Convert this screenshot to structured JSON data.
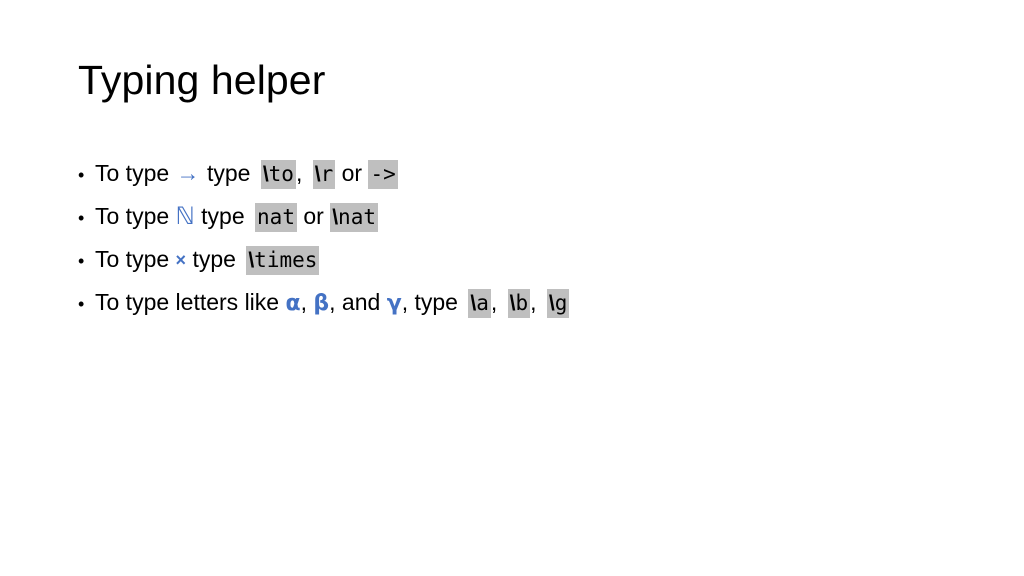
{
  "slide": {
    "title": "Typing helper",
    "background_color": "#FFFFFF",
    "accent_color": "#4472C4",
    "code_highlight_color": "#BFBFBF",
    "text_color": "#000000",
    "bullet_glyph": "•",
    "bullets": [
      {
        "id": "arrow",
        "lead": "To type",
        "symbol": "→",
        "symbol_name": "right-arrow",
        "mid": "type",
        "codes": [
          "\\to",
          "\\r",
          "->"
        ],
        "code_separator_1": ",",
        "code_separator_2": "or"
      },
      {
        "id": "nat",
        "lead": "To type",
        "symbol": "ℕ",
        "symbol_name": "double-struck-capital-n",
        "mid": "type",
        "codes": [
          "nat",
          "\\nat"
        ],
        "code_separator_1": "or"
      },
      {
        "id": "times",
        "lead": "To type",
        "symbol": "×",
        "symbol_name": "multiplication-sign",
        "mid": "type",
        "codes": [
          "\\times"
        ]
      },
      {
        "id": "greek",
        "lead": "To type letters like",
        "symbols": [
          "α",
          "β",
          "γ"
        ],
        "symbol_names": [
          "greek-small-alpha",
          "greek-small-beta",
          "greek-small-gamma"
        ],
        "conjunction": "and",
        "mid": "type",
        "codes": [
          "\\a",
          "\\b",
          "\\g"
        ],
        "comma": ","
      }
    ]
  }
}
